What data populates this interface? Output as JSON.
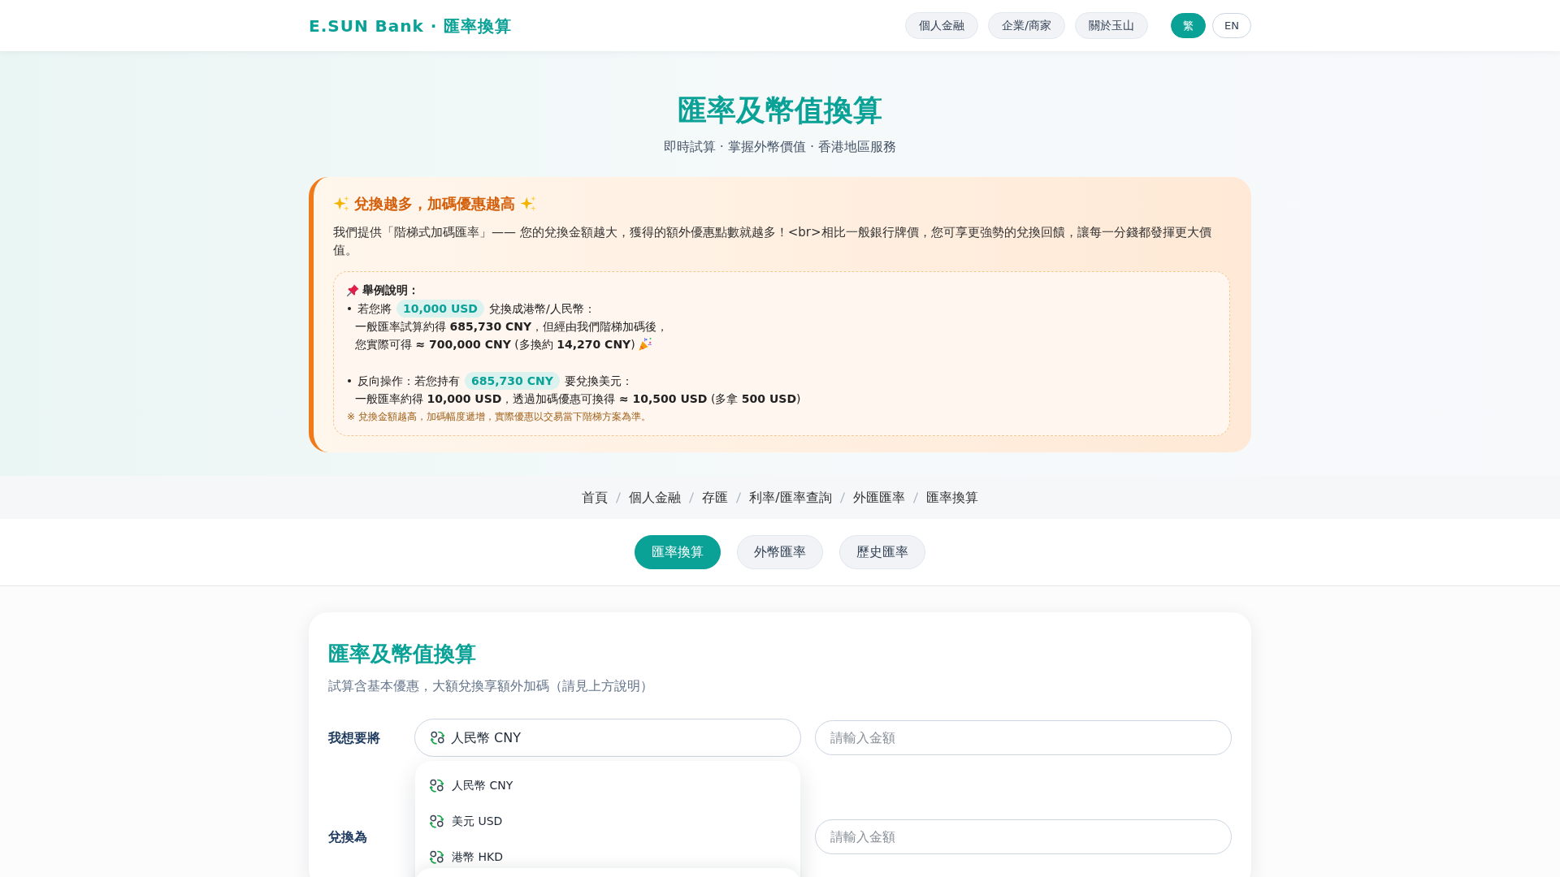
{
  "header": {
    "brand": "E.SUN Bank · 匯率換算",
    "nav": [
      {
        "label": "個人金融"
      },
      {
        "label": "企業/商家"
      },
      {
        "label": "關於玉山"
      }
    ],
    "languages": [
      {
        "label": "繁",
        "selected": true
      },
      {
        "label": "EN",
        "selected": false
      }
    ]
  },
  "hero": {
    "title": "匯率及幣值換算",
    "subtitle": "即時試算 · 掌握外幣價值 · 香港地區服務"
  },
  "promo": {
    "title": "兌換越多，加碼優惠越高",
    "intro": "我們提供「階梯式加碼匯率」—— 您的兌換金額越大，獲得的額外優惠點數就越多！<br>相比一般銀行牌價，您可享更強勢的兌換回饋，讓每一分錢都發揮更大價值。",
    "example": {
      "heading": "舉例說明：",
      "cases": [
        {
          "lead": "若您將",
          "amount": "10,000 USD",
          "tail": "兌換成港幣/人民幣：",
          "details": [
            "一般匯率試算約得 **685,730 CNY**，但經由我們階梯加碼後，",
            "您實際可得 **≈ 700,000 CNY** (多換約 **14,270 CNY**)"
          ],
          "celebrate": true
        },
        {
          "lead": "反向操作：若您持有",
          "amount": "685,730 CNY",
          "tail": "要兌換美元：",
          "details": [
            "一般匯率約得 **10,000 USD**，透過加碼優惠可換得 **≈ 10,500 USD** (多拿 **500 USD**)"
          ],
          "celebrate": false
        }
      ],
      "note": "※ 兌換金額越高，加碼幅度遞增，實際優惠以交易當下階梯方案為準。"
    }
  },
  "breadcrumb": [
    "首頁",
    "個人金融",
    "存匯",
    "利率/匯率查詢",
    "外匯匯率",
    "匯率換算"
  ],
  "tabs": [
    {
      "label": "匯率換算",
      "selected": true
    },
    {
      "label": "外幣匯率",
      "selected": false
    },
    {
      "label": "歷史匯率",
      "selected": false
    }
  ],
  "converter": {
    "title": "匯率及幣值換算",
    "subtitle": "試算含基本優惠，大額兌換享額外加碼（請見上方說明）",
    "rows": [
      {
        "label": "我想要將",
        "currency": "人民幣 CNY",
        "amount_placeholder": "請輸入金額",
        "options": [
          {
            "label": "人民幣 CNY"
          },
          {
            "label": "美元 USD"
          },
          {
            "label": "港幣 HKD"
          }
        ]
      },
      {
        "label": "兌換為",
        "amount_placeholder": "請輸入金額"
      }
    ]
  }
}
